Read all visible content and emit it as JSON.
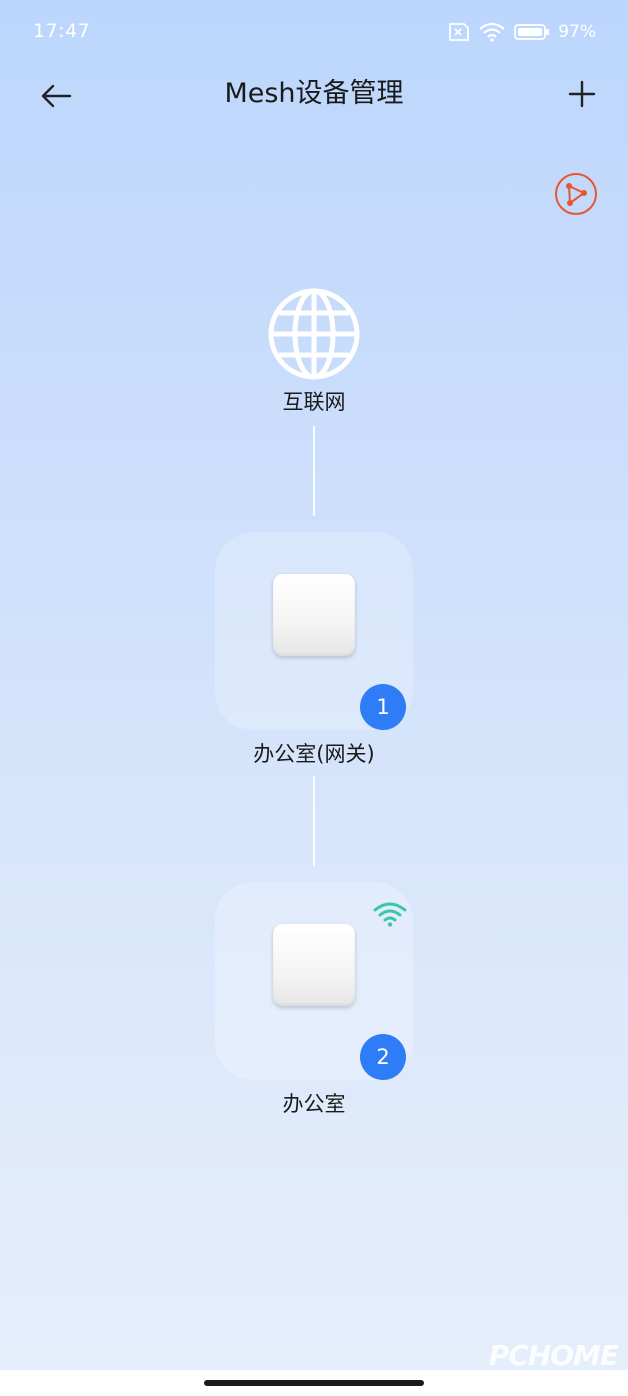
{
  "status_bar": {
    "time": "17:47",
    "battery": "97%"
  },
  "header": {
    "title": "Mesh设备管理"
  },
  "internet": {
    "label": "互联网"
  },
  "devices": [
    {
      "label": "办公室(网关)",
      "index": "1"
    },
    {
      "label": "办公室",
      "index": "2"
    }
  ],
  "watermark": "PCHOME",
  "colors": {
    "accent": "#2f7df6",
    "topology_icon": "#e8552f",
    "wifi_signal": "#3ac7a6"
  }
}
